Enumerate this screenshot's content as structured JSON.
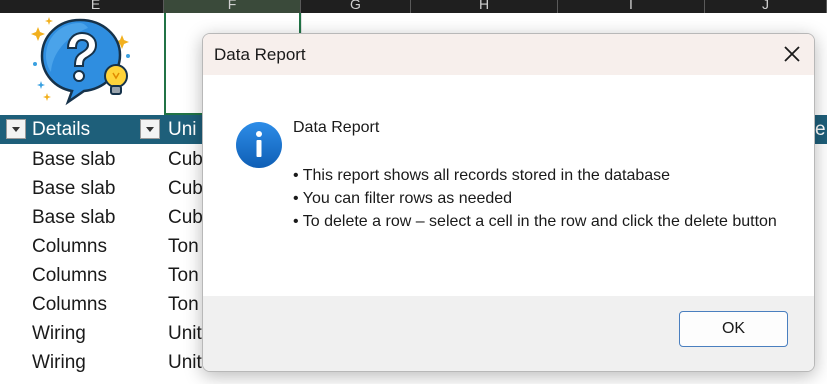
{
  "spreadsheet": {
    "columns": [
      "E",
      "F",
      "G",
      "H",
      "I",
      "J"
    ],
    "table_headers": {
      "details": "Details",
      "unit": "Uni",
      "right_edge": "e"
    },
    "rows": [
      {
        "details": "Base slab",
        "unit": "Cub"
      },
      {
        "details": "Base slab",
        "unit": "Cub"
      },
      {
        "details": "Base slab",
        "unit": "Cub"
      },
      {
        "details": "Columns",
        "unit": "Ton"
      },
      {
        "details": "Columns",
        "unit": "Ton"
      },
      {
        "details": "Columns",
        "unit": "Ton"
      },
      {
        "details": "Wiring",
        "unit": "Unit"
      },
      {
        "details": "Wiring",
        "unit": "Unit"
      }
    ]
  },
  "dialog": {
    "title": "Data Report",
    "message_title": "Data Report",
    "lines": [
      "• This report shows all records stored in the database",
      "• You can filter rows as needed",
      "• To delete a row – select a cell in the row and click the delete button"
    ],
    "ok_label": "OK"
  },
  "colors": {
    "table_header": "#1e5f7a",
    "accent_selection": "#217346",
    "info_icon": "#1a73c9",
    "dialog_title_bg": "#f7efec"
  },
  "icons": {
    "logo": "question-lightbulb-icon",
    "info": "info-icon",
    "close": "close-icon",
    "filter": "filter-dropdown-icon"
  }
}
